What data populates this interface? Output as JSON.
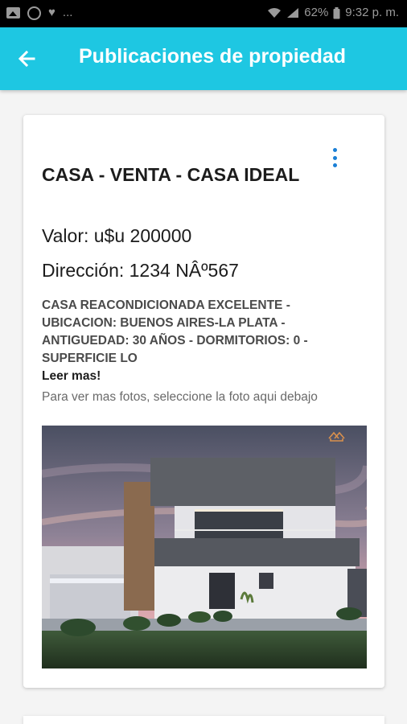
{
  "status_bar": {
    "time": "9:32 p. m.",
    "battery": "62%",
    "more": "...",
    "icons": [
      "image-icon",
      "whatsapp-icon",
      "heart-icon",
      "wifi-icon",
      "signal-icon",
      "battery-icon"
    ]
  },
  "app_bar": {
    "title": "Publicaciones de propiedad",
    "back_icon": "arrow-back-icon",
    "background": "#1ec7e2"
  },
  "listing": {
    "title": "CASA - VENTA - CASA IDEAL",
    "valor": "Valor: u$u 200000",
    "direccion": "Dirección: 1234 NÂº567",
    "description": "CASA REACONDICIONADA EXCELENTE - UBICACION: BUENOS AIRES-LA PLATA - ANTIGUEDAD: 30 AÑOS - DORMITORIOS: 0 - SUPERFICIE LO",
    "read_more": "Leer mas!",
    "photo_hint": "Para ver mas fotos, seleccione la foto aqui debajo",
    "menu_icon": "more-vert-icon",
    "photo_icon": "house-photo",
    "accent": "#1a7fd6"
  }
}
